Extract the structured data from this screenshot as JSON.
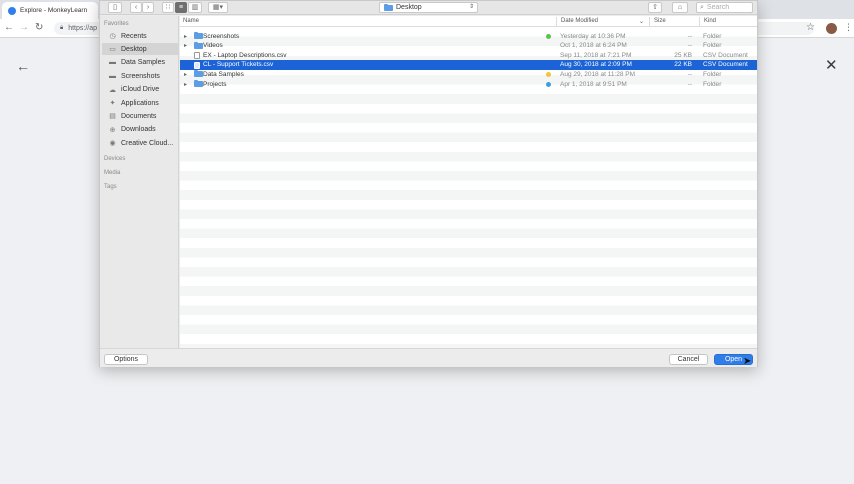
{
  "browser": {
    "tab_title": "Explore - MonkeyLearn",
    "address": "https://ap"
  },
  "dialog": {
    "location": "Desktop",
    "search_placeholder": "Search",
    "sidebar": {
      "favorites_label": "Favorites",
      "items": [
        {
          "label": "Recents",
          "icon": "clock-icon"
        },
        {
          "label": "Desktop",
          "icon": "desktop-icon",
          "selected": true
        },
        {
          "label": "Data Samples",
          "icon": "folder-icon"
        },
        {
          "label": "Screenshots",
          "icon": "folder-icon"
        },
        {
          "label": "iCloud Drive",
          "icon": "cloud-icon"
        },
        {
          "label": "Applications",
          "icon": "applications-icon"
        },
        {
          "label": "Documents",
          "icon": "document-icon"
        },
        {
          "label": "Downloads",
          "icon": "download-icon"
        },
        {
          "label": "Creative Cloud...",
          "icon": "creative-cloud-icon"
        }
      ],
      "devices_label": "Devices",
      "media_label": "Media",
      "tags_label": "Tags"
    },
    "columns": {
      "name": "Name",
      "date": "Date Modified",
      "size": "Size",
      "kind": "Kind"
    },
    "files": [
      {
        "name": "Screenshots",
        "type": "folder",
        "expandable": true,
        "tag_color": "#5cc24f",
        "date": "Yesterday at 10:36 PM",
        "size": "--",
        "kind": "Folder"
      },
      {
        "name": "Videos",
        "type": "folder",
        "expandable": true,
        "tag_color": "",
        "date": "Oct 1, 2018 at 6:24 PM",
        "size": "--",
        "kind": "Folder"
      },
      {
        "name": "EX - Laptop Descriptions.csv",
        "type": "document",
        "expandable": false,
        "tag_color": "",
        "date": "Sep 11, 2018 at 7:21 PM",
        "size": "25 KB",
        "kind": "CSV Document"
      },
      {
        "name": "CL - Support Tickets.csv",
        "type": "document",
        "expandable": false,
        "tag_color": "",
        "date": "Aug 30, 2018 at 2:09 PM",
        "size": "22 KB",
        "kind": "CSV Document",
        "selected": true
      },
      {
        "name": "Data Samples",
        "type": "folder",
        "expandable": true,
        "tag_color": "#f5c33b",
        "date": "Aug 29, 2018 at 11:28 PM",
        "size": "--",
        "kind": "Folder"
      },
      {
        "name": "Projects",
        "type": "folder",
        "expandable": true,
        "tag_color": "#3aa0e0",
        "date": "Apr 1, 2018 at 9:51 PM",
        "size": "--",
        "kind": "Folder"
      }
    ],
    "buttons": {
      "options": "Options",
      "cancel": "Cancel",
      "open": "Open"
    }
  }
}
